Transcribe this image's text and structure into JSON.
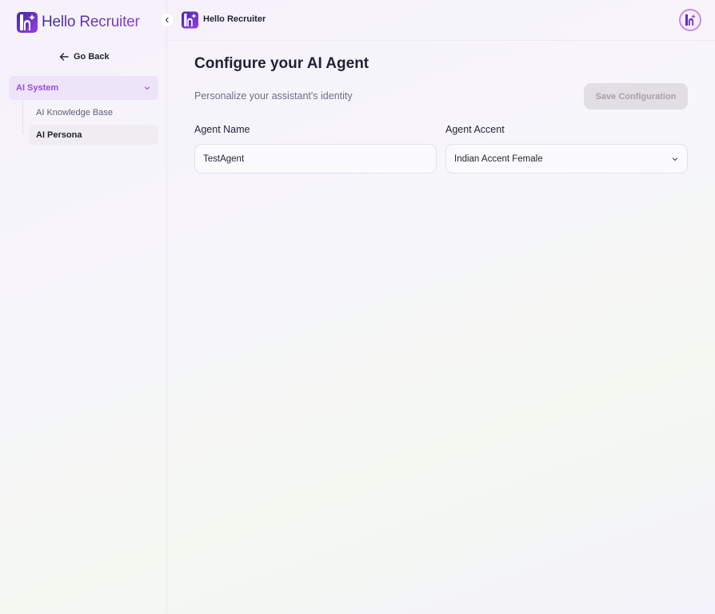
{
  "sidebar": {
    "brand_name": "Hello Recruiter",
    "go_back_label": "Go Back",
    "group": {
      "label": "AI System",
      "items": [
        {
          "label": "AI Knowledge Base",
          "active": false
        },
        {
          "label": "AI Persona",
          "active": true
        }
      ]
    }
  },
  "header": {
    "title": "Hello Recruiter"
  },
  "main": {
    "title": "Configure your AI Agent",
    "subtitle": "Personalize your assistant's identity",
    "save_label": "Save Configuration",
    "agent_name": {
      "label": "Agent Name",
      "value": "TestAgent"
    },
    "agent_accent": {
      "label": "Agent Accent",
      "selected": "Indian Accent Female"
    }
  },
  "colors": {
    "accent": "#9c4ad8",
    "brand_dark": "#3d2a9e",
    "active_group_bg": "#eee4f9"
  },
  "icons": [
    "logo-icon",
    "chevron-left-icon",
    "arrow-left-icon",
    "chevron-down-icon",
    "avatar-icon"
  ]
}
